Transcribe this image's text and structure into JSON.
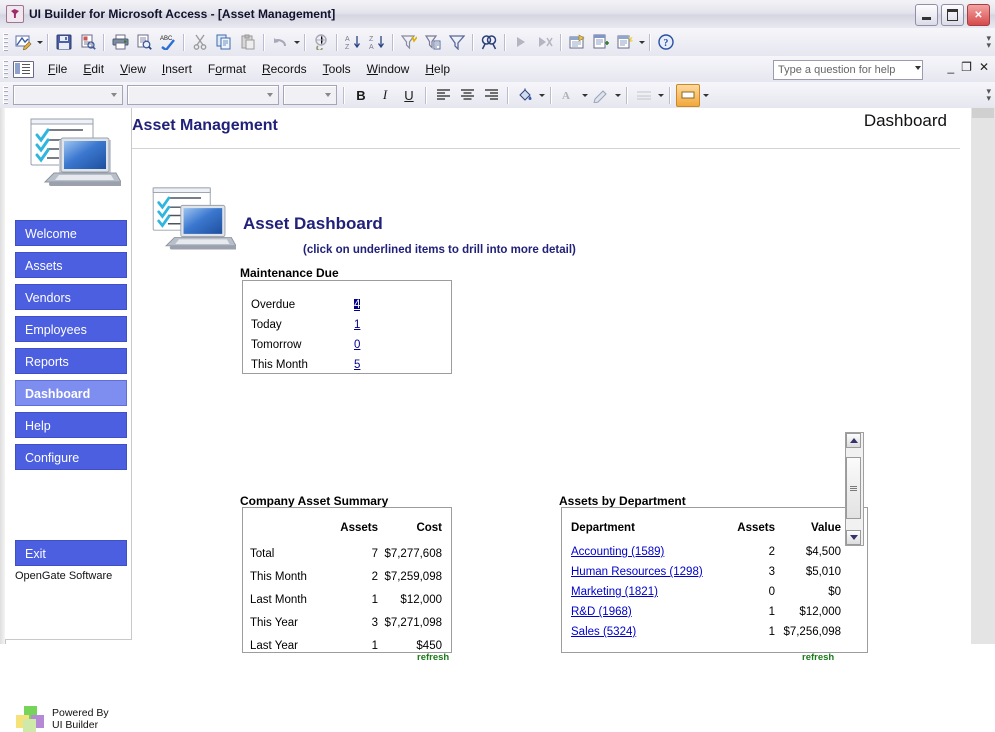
{
  "window": {
    "title": "UI Builder for Microsoft Access - [Asset Management]",
    "app_icon": "access-key-icon",
    "minimize_label": "Minimize",
    "maximize_label": "Maximize",
    "close_label": "Close"
  },
  "menubar": {
    "items": [
      {
        "label": "File",
        "mnemonic": "F"
      },
      {
        "label": "Edit",
        "mnemonic": "E"
      },
      {
        "label": "View",
        "mnemonic": "V"
      },
      {
        "label": "Insert",
        "mnemonic": "I"
      },
      {
        "label": "Format",
        "mnemonic": "o"
      },
      {
        "label": "Records",
        "mnemonic": "R"
      },
      {
        "label": "Tools",
        "mnemonic": "T"
      },
      {
        "label": "Window",
        "mnemonic": "W"
      },
      {
        "label": "Help",
        "mnemonic": "H"
      }
    ],
    "help_search_placeholder": "Type a question for help",
    "mdi_minimize": "_",
    "mdi_restore": "❐",
    "mdi_close": "✕"
  },
  "toolbar": {
    "buttons": [
      {
        "name": "view-design-button",
        "label": "View"
      },
      {
        "name": "save-button",
        "label": "Save"
      },
      {
        "name": "print-preview-button",
        "label": "Print Preview"
      },
      {
        "name": "print-button",
        "label": "Print"
      },
      {
        "name": "print-preview2-button",
        "label": "Preview"
      },
      {
        "name": "spelling-button",
        "label": "Spelling"
      },
      {
        "name": "cut-button",
        "label": "Cut"
      },
      {
        "name": "copy-button",
        "label": "Copy"
      },
      {
        "name": "paste-button",
        "label": "Paste"
      },
      {
        "name": "undo-button",
        "label": "Undo"
      },
      {
        "name": "insert-hyperlink-button",
        "label": "Insert Hyperlink"
      },
      {
        "name": "sort-ascending-button",
        "label": "Sort Ascending"
      },
      {
        "name": "sort-descending-button",
        "label": "Sort Descending"
      },
      {
        "name": "filter-by-selection-button",
        "label": "Filter By Selection"
      },
      {
        "name": "filter-by-form-button",
        "label": "Filter By Form"
      },
      {
        "name": "apply-filter-button",
        "label": "Apply Filter"
      },
      {
        "name": "find-button",
        "label": "Find"
      },
      {
        "name": "new-record-button",
        "label": "New Record"
      },
      {
        "name": "delete-record-button",
        "label": "Delete Record"
      },
      {
        "name": "database-window-button",
        "label": "Database Window"
      },
      {
        "name": "new-object-button",
        "label": "New Object"
      },
      {
        "name": "office-links-button",
        "label": "Office Links"
      },
      {
        "name": "help-button",
        "label": "Microsoft Access Help"
      }
    ]
  },
  "formatbar": {
    "object_combo_value": "",
    "font_combo_value": "",
    "size_combo_value": "",
    "bold_label": "B",
    "italic_label": "I",
    "underline_label": "U",
    "align_left_label": "Align Left",
    "align_center_label": "Center",
    "align_right_label": "Align Right",
    "fill_color_label": "Fill/Back Color",
    "font_color_label": "Font/Fore Color",
    "line_color_label": "Line/Border Color",
    "line_width_label": "Line/Border Width",
    "special_effect_label": "Special Effect"
  },
  "form": {
    "header_title": "Asset Management",
    "header_right": "Dashboard",
    "logo_alt": "asset-checklist-laptop-logo"
  },
  "sidebar": {
    "items": [
      {
        "label": "Welcome",
        "active": false
      },
      {
        "label": "Assets",
        "active": false
      },
      {
        "label": "Vendors",
        "active": false
      },
      {
        "label": "Employees",
        "active": false
      },
      {
        "label": "Reports",
        "active": false
      },
      {
        "label": "Dashboard",
        "active": true
      },
      {
        "label": "Help",
        "active": false
      },
      {
        "label": "Configure",
        "active": false
      }
    ],
    "exit_label": "Exit",
    "company": "OpenGate Software",
    "powered_line1": "Powered By",
    "powered_line2": "UI Builder"
  },
  "dashboard": {
    "title": "Asset Dashboard",
    "subtitle": "(click on underlined items to drill into more detail)",
    "maintenance": {
      "label": "Maintenance Due",
      "rows": [
        {
          "label": "Overdue",
          "value": "4",
          "selected": true
        },
        {
          "label": "Today",
          "value": "1",
          "selected": false
        },
        {
          "label": "Tomorrow",
          "value": "0",
          "selected": false
        },
        {
          "label": "This Month",
          "value": "5",
          "selected": false
        }
      ]
    },
    "summary": {
      "label": "Company Asset Summary",
      "columns": [
        "",
        "Assets",
        "Cost"
      ],
      "rows": [
        {
          "label": "Total",
          "assets": "7",
          "cost": "$7,277,608"
        },
        {
          "label": "This Month",
          "assets": "2",
          "cost": "$7,259,098"
        },
        {
          "label": "Last Month",
          "assets": "1",
          "cost": "$12,000"
        },
        {
          "label": "This Year",
          "assets": "3",
          "cost": "$7,271,098"
        },
        {
          "label": "Last Year",
          "assets": "1",
          "cost": "$450"
        }
      ],
      "refresh_label": "refresh"
    },
    "departments": {
      "label": "Assets by Department",
      "columns": [
        "Department",
        "Assets",
        "Value"
      ],
      "rows": [
        {
          "department": "Accounting (1589)",
          "assets": "2",
          "value": "$4,500"
        },
        {
          "department": "Human Resources (1298)",
          "assets": "3",
          "value": "$5,010"
        },
        {
          "department": "Marketing (1821)",
          "assets": "0",
          "value": "$0"
        },
        {
          "department": "R&D (1968)",
          "assets": "1",
          "value": "$12,000"
        },
        {
          "department": "Sales (5324)",
          "assets": "1",
          "value": "$7,256,098"
        }
      ],
      "refresh_label": "refresh",
      "scroll_up_label": "Scroll up",
      "scroll_down_label": "Scroll down"
    }
  },
  "colors": {
    "title_blue": "#21217a",
    "nav_blue": "#4b5fe0",
    "nav_active_blue": "#7d8df0",
    "link_blue": "#0000cc",
    "refresh_green": "#1a7a1a",
    "selection_navy": "#00008b"
  }
}
